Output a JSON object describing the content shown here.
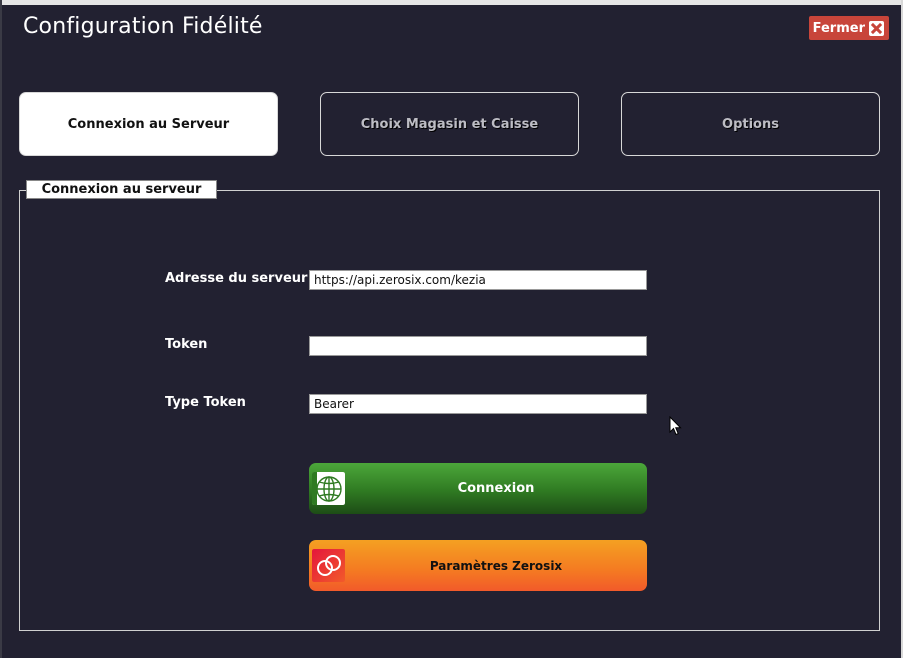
{
  "window": {
    "title": "Configuration Fidélité",
    "close_label": "Fermer"
  },
  "tabs": [
    {
      "label": "Connexion au Serveur",
      "active": true
    },
    {
      "label": "Choix Magasin et Caisse",
      "active": false
    },
    {
      "label": "Options",
      "active": false
    }
  ],
  "panel": {
    "title": "Connexion au serveur",
    "fields": {
      "server_address": {
        "label": "Adresse du serveur",
        "value": "https://api.zerosix.com/kezia"
      },
      "token": {
        "label": "Token",
        "value": ""
      },
      "token_type": {
        "label": "Type Token",
        "value": "Bearer"
      }
    },
    "connect_button": {
      "label": "Connexion",
      "icon": "globe-icon"
    },
    "zerosix_button": {
      "label": "Paramètres Zerosix",
      "icon": "zerosix-logo-icon"
    }
  },
  "colors": {
    "background": "#222131",
    "close_button": "#c8453a",
    "connect_button": "#2f7a22",
    "zerosix_button": "#f47a22"
  }
}
